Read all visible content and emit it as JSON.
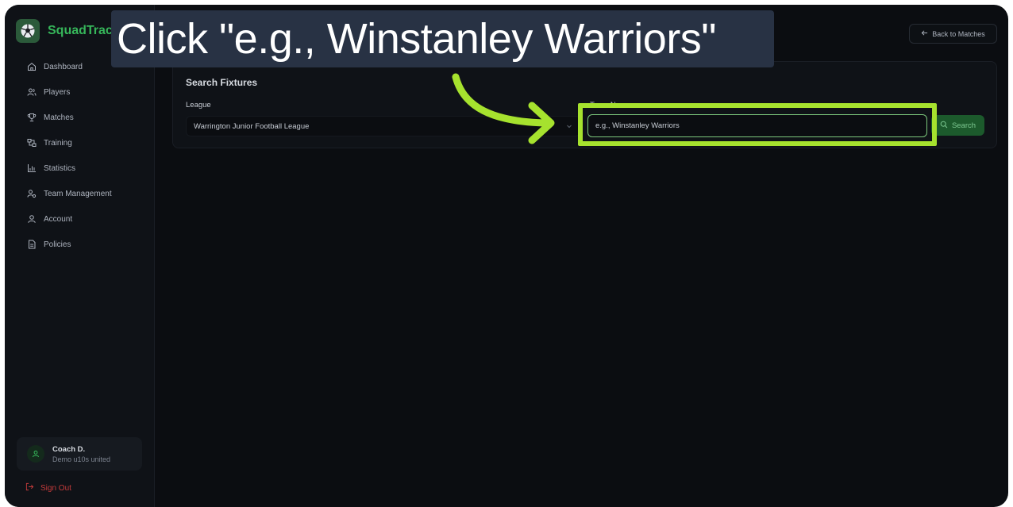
{
  "app": {
    "name": "SquadTrac"
  },
  "sidebar": {
    "items": [
      {
        "label": "Dashboard",
        "icon": "home-icon"
      },
      {
        "label": "Players",
        "icon": "users-icon"
      },
      {
        "label": "Matches",
        "icon": "trophy-icon"
      },
      {
        "label": "Training",
        "icon": "training-icon"
      },
      {
        "label": "Statistics",
        "icon": "chart-icon"
      },
      {
        "label": "Team Management",
        "icon": "team-management-icon"
      },
      {
        "label": "Account",
        "icon": "user-icon"
      },
      {
        "label": "Policies",
        "icon": "document-icon"
      }
    ],
    "user": {
      "name": "Coach D.",
      "team": "Demo u10s united"
    },
    "sign_out": "Sign Out"
  },
  "header": {
    "back_label": "Back to Matches"
  },
  "search": {
    "title": "Search Fixtures",
    "league_label": "League",
    "league_value": "Warrington Junior Football League",
    "team_label": "Team Name",
    "team_placeholder": "e.g., Winstanley Warriors",
    "button_label": "Search"
  },
  "tutorial": {
    "instruction": "Click \"e.g., Winstanley Warriors\""
  },
  "colors": {
    "accent_green": "#36b65a",
    "highlight": "#a6e22e",
    "danger": "#c53b3b",
    "background": "#0b0d11"
  }
}
